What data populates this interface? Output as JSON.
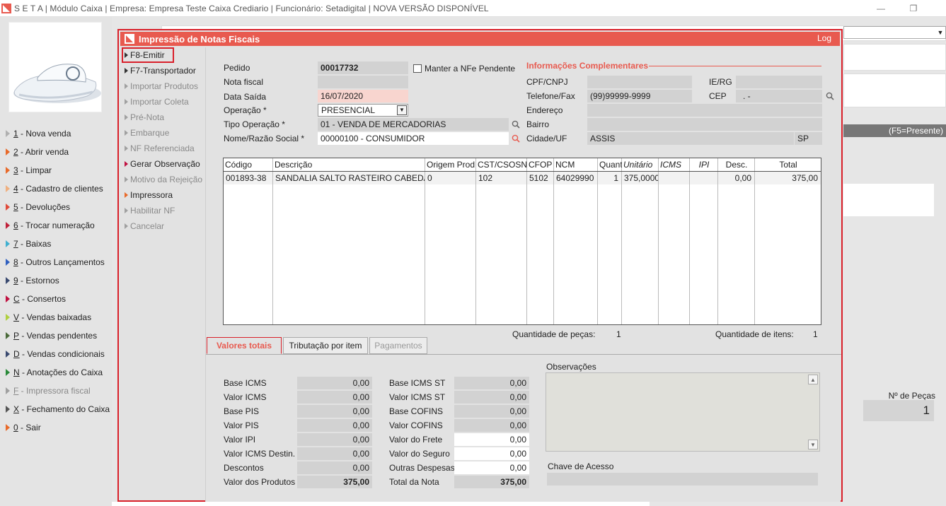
{
  "window": {
    "title": "S E T A | Módulo Caixa | Empresa: Empresa Teste Caixa Crediario | Funcionário: Setadigital | NOVA VERSÃO DISPONÍVEL",
    "minimize": "—",
    "restore": "❐"
  },
  "colors": {
    "accent": "#e85a4f",
    "highlight": "#d9202a"
  },
  "sidebar": {
    "items": [
      {
        "key": "1",
        "label": " - Nova venda",
        "color": "#b0b0b0",
        "disabled": false
      },
      {
        "key": "2",
        "label": " - Abrir venda",
        "color": "#e86a2a",
        "disabled": false
      },
      {
        "key": "3",
        "label": " - Limpar",
        "color": "#e86a2a",
        "disabled": false
      },
      {
        "key": "4",
        "label": " - Cadastro de clientes",
        "color": "#f0b080",
        "disabled": false
      },
      {
        "key": "5",
        "label": " - Devoluções",
        "color": "#e04a3a",
        "disabled": false
      },
      {
        "key": "6",
        "label": " - Trocar numeração",
        "color": "#c0203a",
        "disabled": false
      },
      {
        "key": "7",
        "label": " - Baixas",
        "color": "#40b0d0",
        "disabled": false
      },
      {
        "key": "8",
        "label": " - Outros Lançamentos",
        "color": "#3060c0",
        "disabled": false
      },
      {
        "key": "9",
        "label": " - Estornos",
        "color": "#3a4a70",
        "disabled": false
      },
      {
        "key": "C",
        "label": " - Consertos",
        "color": "#c01040",
        "disabled": false
      },
      {
        "key": "V",
        "label": " - Vendas baixadas",
        "color": "#b0d040",
        "disabled": false
      },
      {
        "key": "P",
        "label": " - Vendas pendentes",
        "color": "#4a6a3a",
        "disabled": false
      },
      {
        "key": "D",
        "label": " - Vendas condicionais",
        "color": "#3a4a70",
        "disabled": false
      },
      {
        "key": "N",
        "label": " - Anotações do Caixa",
        "color": "#2a8a3a",
        "disabled": false
      },
      {
        "key": "F",
        "label": " - Impressora fiscal",
        "color": "#a0a0a0",
        "disabled": true
      },
      {
        "key": "X",
        "label": " - Fechamento do Caixa",
        "color": "#555555",
        "disabled": false
      },
      {
        "key": "0",
        "label": " - Sair",
        "color": "#e86a2a",
        "disabled": false
      }
    ]
  },
  "background": {
    "status_bar": "(F5=Presente)",
    "pecas_label": "Nº de Peças",
    "pecas_value": "1"
  },
  "modal": {
    "title": "Impressão de Notas Fiscais",
    "log": "Log",
    "menu": [
      {
        "label": "F8-Emitir",
        "disabled": false,
        "tri": "#333333"
      },
      {
        "label": "F7-Transportador",
        "disabled": false,
        "tri": "#333333"
      },
      {
        "label": "Importar Produtos",
        "disabled": true,
        "tri": "#a0a0a0"
      },
      {
        "label": "Importar Coleta",
        "disabled": true,
        "tri": "#a0a0a0"
      },
      {
        "label": "Pré-Nota",
        "disabled": true,
        "tri": "#a0a0a0"
      },
      {
        "label": "Embarque",
        "disabled": true,
        "tri": "#a0a0a0"
      },
      {
        "label": "NF Referenciada",
        "disabled": true,
        "tri": "#a0a0a0"
      },
      {
        "label": "Gerar Observação",
        "disabled": false,
        "tri": "#c01040"
      },
      {
        "label": "Motivo da Rejeição",
        "disabled": true,
        "tri": "#a0a0a0"
      },
      {
        "label": "Impressora",
        "disabled": false,
        "tri": "#e86a2a"
      },
      {
        "label": "Habilitar NF",
        "disabled": true,
        "tri": "#a0a0a0"
      },
      {
        "label": "Cancelar",
        "disabled": true,
        "tri": "#a0a0a0"
      }
    ],
    "form": {
      "pedido_label": "Pedido",
      "pedido": "00017732",
      "nota_label": "Nota fiscal",
      "nota": "",
      "data_label": "Data Saída",
      "data": "16/07/2020",
      "operacao_label": "Operação *",
      "operacao": "PRESENCIAL",
      "tipo_label": "Tipo Operação *",
      "tipo": "01 - VENDA DE MERCADORIAS",
      "nome_label": "Nome/Razão Social *",
      "nome": "00000100 - CONSUMIDOR",
      "manter_label": "Manter a NFe Pendente"
    },
    "info": {
      "title": "Informações Complementares",
      "cpf_label": "CPF/CNPJ",
      "cpf": "",
      "ie_label": "IE/RG",
      "ie": "",
      "tel_label": "Telefone/Fax",
      "tel": "(99)99999-9999",
      "cep_label": "CEP",
      "cep": ". -",
      "end_label": "Endereço",
      "end": "",
      "bairro_label": "Bairro",
      "bairro": "",
      "cidade_label": "Cidade/UF",
      "cidade": "ASSIS",
      "uf": "SP"
    },
    "grid": {
      "headers": [
        "Código",
        "Descrição",
        "Origem Prod",
        "CST/CSOSN",
        "CFOP",
        "NCM",
        "Quant",
        "Unitário",
        "ICMS",
        "IPI",
        "Desc.",
        "Total"
      ],
      "rows": [
        [
          "001893-38",
          "SANDALIA SALTO RASTEIRO CABEDAL IN",
          "0",
          "102",
          "5102",
          "64029990",
          "1",
          "375,0000",
          "",
          "",
          "0,00",
          "375,00"
        ]
      ]
    },
    "totals": {
      "pecas_label": "Quantidade de peças:",
      "pecas": "1",
      "itens_label": "Quantidade de itens:",
      "itens": "1"
    },
    "tabs": [
      {
        "label": "Valores totais",
        "state": "active"
      },
      {
        "label": "Tributação por item",
        "state": "normal"
      },
      {
        "label": "Pagamentos",
        "state": "disabled"
      }
    ],
    "valores_left": [
      {
        "label": "Base ICMS",
        "value": "0,00"
      },
      {
        "label": "Valor ICMS",
        "value": "0,00"
      },
      {
        "label": "Base PIS",
        "value": "0,00"
      },
      {
        "label": "Valor PIS",
        "value": "0,00"
      },
      {
        "label": "Valor IPI",
        "value": "0,00"
      },
      {
        "label": "Valor ICMS Destin.",
        "value": "0,00"
      },
      {
        "label": "Descontos",
        "value": "0,00"
      },
      {
        "label": "Valor dos Produtos",
        "value": "375,00"
      }
    ],
    "valores_right": [
      {
        "label": "Base ICMS ST",
        "value": "0,00"
      },
      {
        "label": "Valor ICMS ST",
        "value": "0,00"
      },
      {
        "label": "Base COFINS",
        "value": "0,00"
      },
      {
        "label": "Valor COFINS",
        "value": "0,00"
      },
      {
        "label": "Valor do Frete",
        "value": "0,00"
      },
      {
        "label": "Valor do Seguro",
        "value": "0,00"
      },
      {
        "label": "Outras Despesas",
        "value": "0,00"
      },
      {
        "label": "Total da Nota",
        "value": "375,00"
      }
    ],
    "observacoes_label": "Observações",
    "chave_label": "Chave de Acesso",
    "chave": ""
  }
}
